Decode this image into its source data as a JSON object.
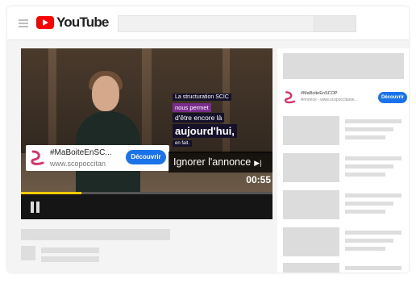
{
  "header": {
    "brand": "YouTube",
    "icons": [
      "hamburger-icon",
      "youtube-play-icon"
    ]
  },
  "player": {
    "subtitles": [
      "La structuration SCIC",
      "nous permet",
      "d'être encore là",
      "aujourd'hui,",
      "en fait."
    ],
    "ad": {
      "title": "#MaBoiteEnSC...",
      "url": "www.scopoccitan",
      "cta": "Découvrir"
    },
    "skip_label": "Ignorer l'annonce",
    "skip_icon": "skip-next-icon",
    "time_remaining": "00:55",
    "progress": 0.24,
    "colors": {
      "progress": "#ffcc00",
      "cta": "#1a73e8",
      "brand": "#ff0000"
    }
  },
  "sidebar": {
    "ad": {
      "title": "#MaBoiteEnSCOP",
      "url": "Annonce · www.scopoccitanie...",
      "cta": "Découvrir"
    }
  }
}
